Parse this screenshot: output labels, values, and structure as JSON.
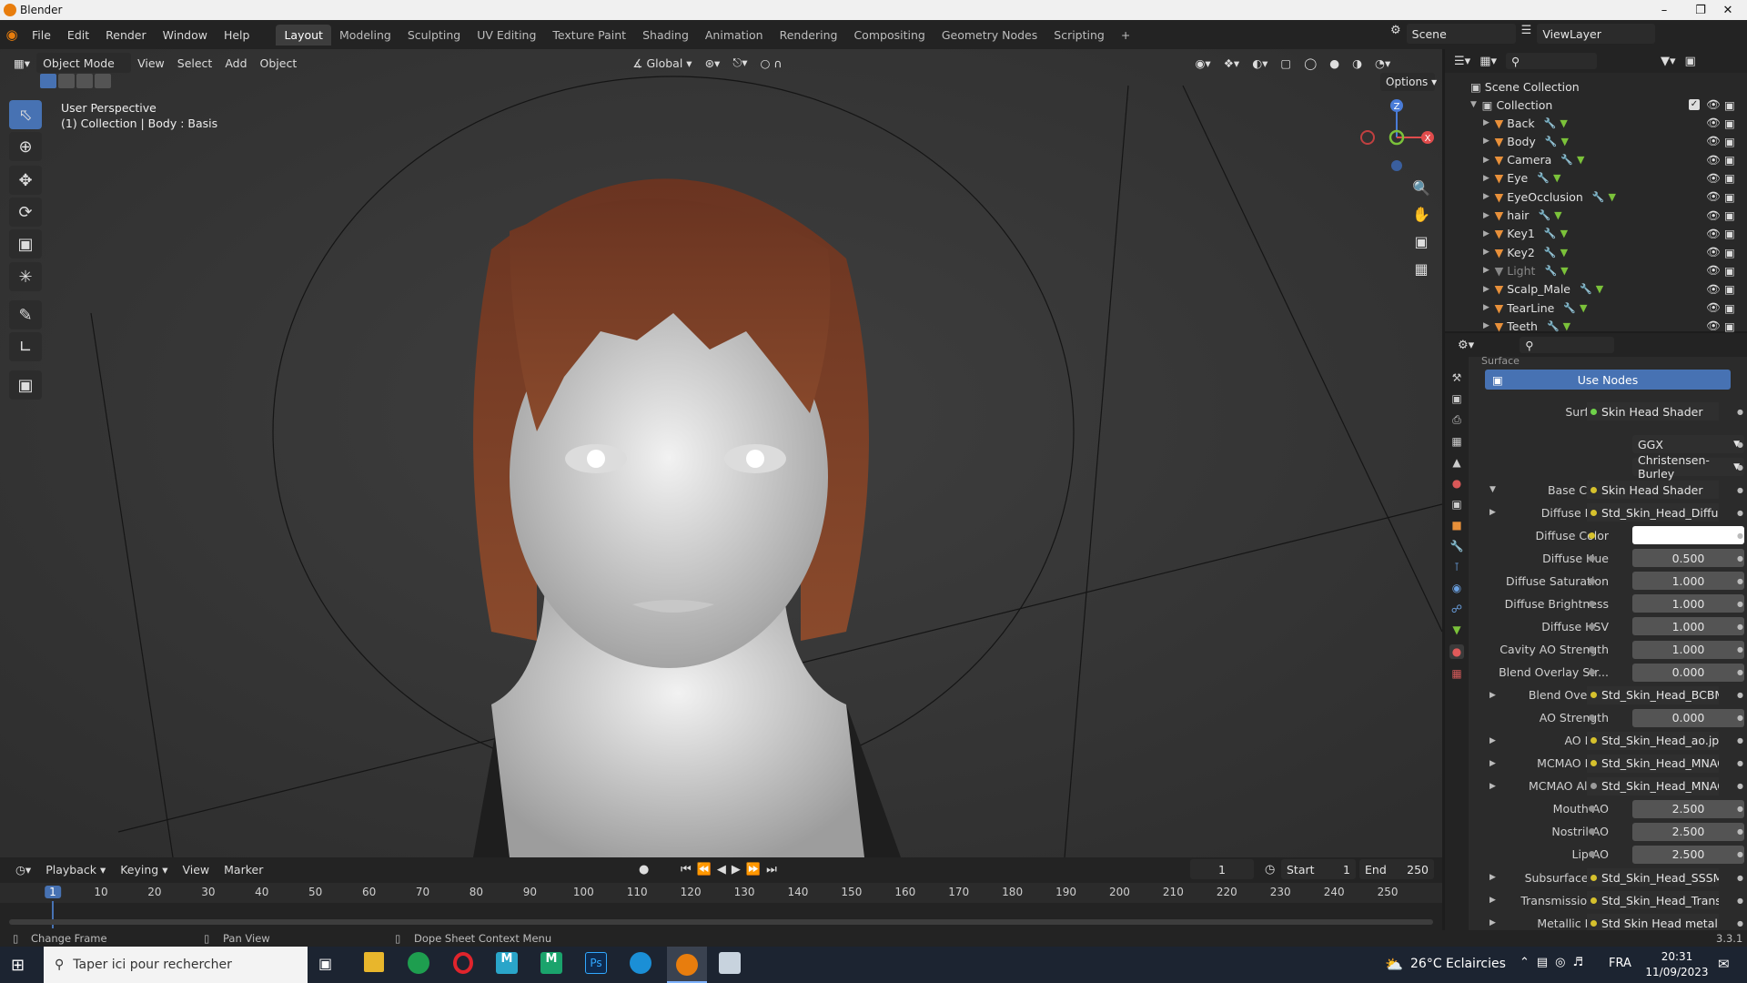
{
  "window": {
    "title": "Blender"
  },
  "menus": [
    "File",
    "Edit",
    "Render",
    "Window",
    "Help"
  ],
  "workspaces": [
    "Layout",
    "Modeling",
    "Sculpting",
    "UV Editing",
    "Texture Paint",
    "Shading",
    "Animation",
    "Rendering",
    "Compositing",
    "Geometry Nodes",
    "Scripting"
  ],
  "active_workspace": "Layout",
  "scene": "Scene",
  "view_layer": "ViewLayer",
  "viewport": {
    "mode": "Object Mode",
    "menus": [
      "View",
      "Select",
      "Add",
      "Object"
    ],
    "transform": "Global",
    "options": "Options",
    "overlay_line1": "User Perspective",
    "overlay_line2": "(1) Collection | Body : Basis",
    "gizmo": {
      "z": "Z",
      "x": "X"
    }
  },
  "outliner": {
    "root": "Scene Collection",
    "collection": "Collection",
    "items": [
      "Back",
      "Body",
      "Camera",
      "Eye",
      "EyeOcclusion",
      "hair",
      "Key1",
      "Key2",
      "Light",
      "Scalp_Male",
      "TearLine",
      "Teeth"
    ]
  },
  "properties": {
    "panel_partial": "Surface",
    "use_nodes": "Use Nodes",
    "rows": [
      {
        "label": "Surface",
        "kind": "link",
        "value": "Skin Head Shader",
        "dot": "#6fd24a"
      },
      {
        "label": "",
        "kind": "select",
        "value": "GGX"
      },
      {
        "label": "",
        "kind": "select",
        "value": "Christensen-Burley"
      },
      {
        "label": "Base Color",
        "kind": "link",
        "value": "Skin Head Shader",
        "dot": "#d6c12d",
        "expanded": true
      },
      {
        "label": "Diffuse Map",
        "kind": "link",
        "value": "Std_Skin_Head_Diffuse",
        "dot": "#d6c12d",
        "collapsed": true
      },
      {
        "label": "Diffuse Color",
        "kind": "color",
        "value": "",
        "dot": "#d6c12d"
      },
      {
        "label": "Diffuse Hue",
        "kind": "num",
        "value": "0.500"
      },
      {
        "label": "Diffuse Saturation",
        "kind": "num",
        "value": "1.000"
      },
      {
        "label": "Diffuse Brightness",
        "kind": "num",
        "value": "1.000"
      },
      {
        "label": "Diffuse HSV",
        "kind": "num",
        "value": "1.000"
      },
      {
        "label": "Cavity AO Strength",
        "kind": "num",
        "value": "1.000"
      },
      {
        "label": "Blend Overlay Str...",
        "kind": "num",
        "value": "0.000"
      },
      {
        "label": "Blend Overlay",
        "kind": "link",
        "value": "Std_Skin_Head_BCBMa...",
        "dot": "#d6c12d",
        "collapsed": true
      },
      {
        "label": "AO Strength",
        "kind": "num",
        "value": "0.000"
      },
      {
        "label": "AO Map",
        "kind": "link",
        "value": "Std_Skin_Head_ao.jpg",
        "dot": "#d6c12d",
        "collapsed": true
      },
      {
        "label": "MCMAO Map",
        "kind": "link",
        "value": "Std_Skin_Head_MNAOM",
        "dot": "#d6c12d",
        "collapsed": true
      },
      {
        "label": "MCMAO Alpha",
        "kind": "link",
        "value": "Std_Skin_Head_MNAOM",
        "dot": "#9a9a9a",
        "collapsed": true
      },
      {
        "label": "Mouth AO",
        "kind": "num",
        "value": "2.500"
      },
      {
        "label": "Nostril AO",
        "kind": "num",
        "value": "2.500"
      },
      {
        "label": "Lip AO",
        "kind": "num",
        "value": "2.500"
      },
      {
        "label": "Subsurface Ma",
        "kind": "link",
        "value": "Std_Skin_Head_SSSMap...",
        "dot": "#d6c12d",
        "collapsed": true
      },
      {
        "label": "Transmission ...",
        "kind": "link",
        "value": "Std_Skin_Head_TransM...",
        "dot": "#d6c12d",
        "collapsed": true
      },
      {
        "label": "Metallic Map",
        "kind": "link",
        "value": "Std Skin Head metallic",
        "dot": "#d6c12d",
        "collapsed": true
      }
    ]
  },
  "timeline": {
    "menus": [
      "Playback",
      "Keying",
      "View",
      "Marker"
    ],
    "current_frame": "1",
    "start_label": "Start",
    "start": "1",
    "end_label": "End",
    "end": "250",
    "ticks": [
      "1",
      "10",
      "20",
      "30",
      "40",
      "50",
      "60",
      "70",
      "80",
      "90",
      "100",
      "110",
      "120",
      "130",
      "140",
      "150",
      "160",
      "170",
      "180",
      "190",
      "200",
      "210",
      "220",
      "230",
      "240",
      "250"
    ]
  },
  "statusbar": {
    "change_frame": "Change Frame",
    "pan_view": "Pan View",
    "context_menu": "Dope Sheet Context Menu",
    "version": "3.3.1"
  },
  "taskbar": {
    "search": "Taper ici pour rechercher",
    "weather": "26°C  Eclaircies",
    "lang": "FRA",
    "time": "20:31",
    "date": "11/09/2023"
  }
}
